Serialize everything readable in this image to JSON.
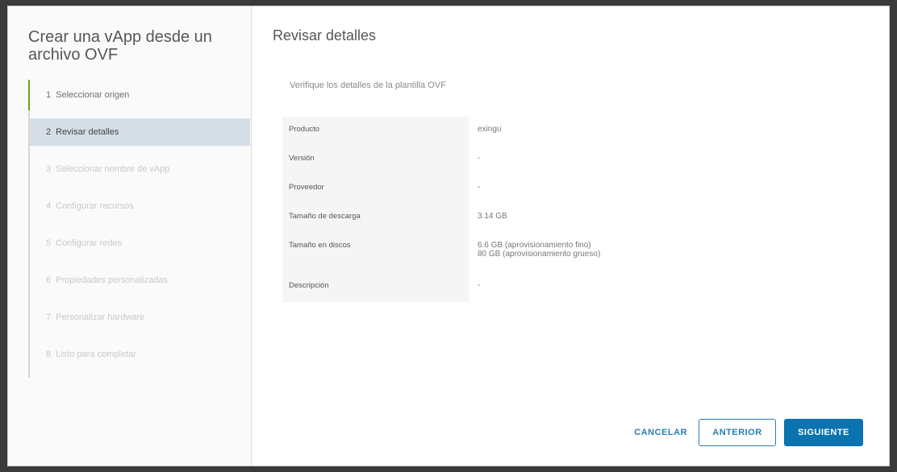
{
  "dialog": {
    "title": "Crear una vApp desde un archivo OVF",
    "steps": [
      {
        "num": "1",
        "label": "Seleccionar origen"
      },
      {
        "num": "2",
        "label": "Revisar detalles"
      },
      {
        "num": "3",
        "label": "Seleccionar nombre de vApp"
      },
      {
        "num": "4",
        "label": "Configurar recursos"
      },
      {
        "num": "5",
        "label": "Configurar redes"
      },
      {
        "num": "6",
        "label": "Propiedades personalizadas"
      },
      {
        "num": "7",
        "label": "Personalizar hardware"
      },
      {
        "num": "8",
        "label": "Listo para completar"
      }
    ]
  },
  "main": {
    "title": "Revisar detalles",
    "intro": "Verifique los detalles de la plantilla OVF",
    "details": [
      {
        "key": "Producto",
        "value": "exingu",
        "value2": ""
      },
      {
        "key": "Versión",
        "value": "-",
        "value2": ""
      },
      {
        "key": "Proveedor",
        "value": "-",
        "value2": ""
      },
      {
        "key": "Tamaño de descarga",
        "value": "3.14 GB",
        "value2": ""
      },
      {
        "key": "Tamaño en discos",
        "value": "6.6 GB (aprovisionamiento fino)",
        "value2": "80 GB (aprovisionamiento grueso)"
      },
      {
        "key": "Descripción",
        "value": "-",
        "value2": ""
      }
    ]
  },
  "footer": {
    "cancel": "CANCELAR",
    "back": "ANTERIOR",
    "next": "SIGUIENTE"
  }
}
